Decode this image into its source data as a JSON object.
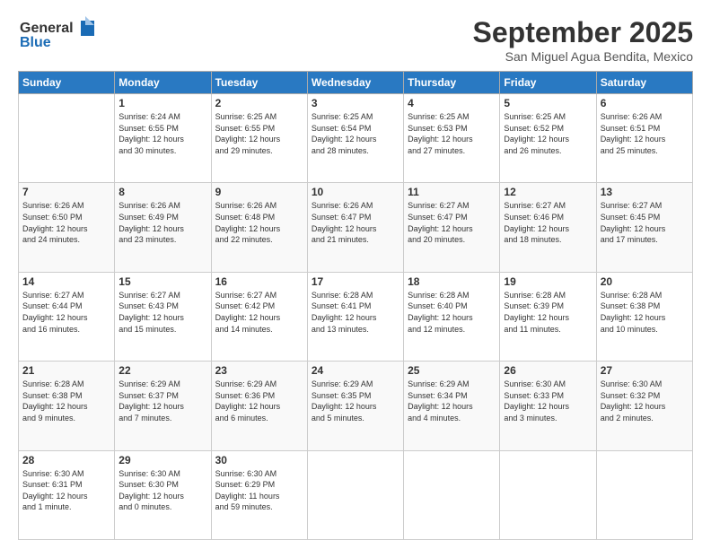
{
  "logo": {
    "line1": "General",
    "line2": "Blue"
  },
  "title": "September 2025",
  "location": "San Miguel Agua Bendita, Mexico",
  "weekdays": [
    "Sunday",
    "Monday",
    "Tuesday",
    "Wednesday",
    "Thursday",
    "Friday",
    "Saturday"
  ],
  "weeks": [
    [
      {
        "day": "",
        "info": ""
      },
      {
        "day": "1",
        "info": "Sunrise: 6:24 AM\nSunset: 6:55 PM\nDaylight: 12 hours\nand 30 minutes."
      },
      {
        "day": "2",
        "info": "Sunrise: 6:25 AM\nSunset: 6:55 PM\nDaylight: 12 hours\nand 29 minutes."
      },
      {
        "day": "3",
        "info": "Sunrise: 6:25 AM\nSunset: 6:54 PM\nDaylight: 12 hours\nand 28 minutes."
      },
      {
        "day": "4",
        "info": "Sunrise: 6:25 AM\nSunset: 6:53 PM\nDaylight: 12 hours\nand 27 minutes."
      },
      {
        "day": "5",
        "info": "Sunrise: 6:25 AM\nSunset: 6:52 PM\nDaylight: 12 hours\nand 26 minutes."
      },
      {
        "day": "6",
        "info": "Sunrise: 6:26 AM\nSunset: 6:51 PM\nDaylight: 12 hours\nand 25 minutes."
      }
    ],
    [
      {
        "day": "7",
        "info": "Sunrise: 6:26 AM\nSunset: 6:50 PM\nDaylight: 12 hours\nand 24 minutes."
      },
      {
        "day": "8",
        "info": "Sunrise: 6:26 AM\nSunset: 6:49 PM\nDaylight: 12 hours\nand 23 minutes."
      },
      {
        "day": "9",
        "info": "Sunrise: 6:26 AM\nSunset: 6:48 PM\nDaylight: 12 hours\nand 22 minutes."
      },
      {
        "day": "10",
        "info": "Sunrise: 6:26 AM\nSunset: 6:47 PM\nDaylight: 12 hours\nand 21 minutes."
      },
      {
        "day": "11",
        "info": "Sunrise: 6:27 AM\nSunset: 6:47 PM\nDaylight: 12 hours\nand 20 minutes."
      },
      {
        "day": "12",
        "info": "Sunrise: 6:27 AM\nSunset: 6:46 PM\nDaylight: 12 hours\nand 18 minutes."
      },
      {
        "day": "13",
        "info": "Sunrise: 6:27 AM\nSunset: 6:45 PM\nDaylight: 12 hours\nand 17 minutes."
      }
    ],
    [
      {
        "day": "14",
        "info": "Sunrise: 6:27 AM\nSunset: 6:44 PM\nDaylight: 12 hours\nand 16 minutes."
      },
      {
        "day": "15",
        "info": "Sunrise: 6:27 AM\nSunset: 6:43 PM\nDaylight: 12 hours\nand 15 minutes."
      },
      {
        "day": "16",
        "info": "Sunrise: 6:27 AM\nSunset: 6:42 PM\nDaylight: 12 hours\nand 14 minutes."
      },
      {
        "day": "17",
        "info": "Sunrise: 6:28 AM\nSunset: 6:41 PM\nDaylight: 12 hours\nand 13 minutes."
      },
      {
        "day": "18",
        "info": "Sunrise: 6:28 AM\nSunset: 6:40 PM\nDaylight: 12 hours\nand 12 minutes."
      },
      {
        "day": "19",
        "info": "Sunrise: 6:28 AM\nSunset: 6:39 PM\nDaylight: 12 hours\nand 11 minutes."
      },
      {
        "day": "20",
        "info": "Sunrise: 6:28 AM\nSunset: 6:38 PM\nDaylight: 12 hours\nand 10 minutes."
      }
    ],
    [
      {
        "day": "21",
        "info": "Sunrise: 6:28 AM\nSunset: 6:38 PM\nDaylight: 12 hours\nand 9 minutes."
      },
      {
        "day": "22",
        "info": "Sunrise: 6:29 AM\nSunset: 6:37 PM\nDaylight: 12 hours\nand 7 minutes."
      },
      {
        "day": "23",
        "info": "Sunrise: 6:29 AM\nSunset: 6:36 PM\nDaylight: 12 hours\nand 6 minutes."
      },
      {
        "day": "24",
        "info": "Sunrise: 6:29 AM\nSunset: 6:35 PM\nDaylight: 12 hours\nand 5 minutes."
      },
      {
        "day": "25",
        "info": "Sunrise: 6:29 AM\nSunset: 6:34 PM\nDaylight: 12 hours\nand 4 minutes."
      },
      {
        "day": "26",
        "info": "Sunrise: 6:30 AM\nSunset: 6:33 PM\nDaylight: 12 hours\nand 3 minutes."
      },
      {
        "day": "27",
        "info": "Sunrise: 6:30 AM\nSunset: 6:32 PM\nDaylight: 12 hours\nand 2 minutes."
      }
    ],
    [
      {
        "day": "28",
        "info": "Sunrise: 6:30 AM\nSunset: 6:31 PM\nDaylight: 12 hours\nand 1 minute."
      },
      {
        "day": "29",
        "info": "Sunrise: 6:30 AM\nSunset: 6:30 PM\nDaylight: 12 hours\nand 0 minutes."
      },
      {
        "day": "30",
        "info": "Sunrise: 6:30 AM\nSunset: 6:29 PM\nDaylight: 11 hours\nand 59 minutes."
      },
      {
        "day": "",
        "info": ""
      },
      {
        "day": "",
        "info": ""
      },
      {
        "day": "",
        "info": ""
      },
      {
        "day": "",
        "info": ""
      }
    ]
  ]
}
